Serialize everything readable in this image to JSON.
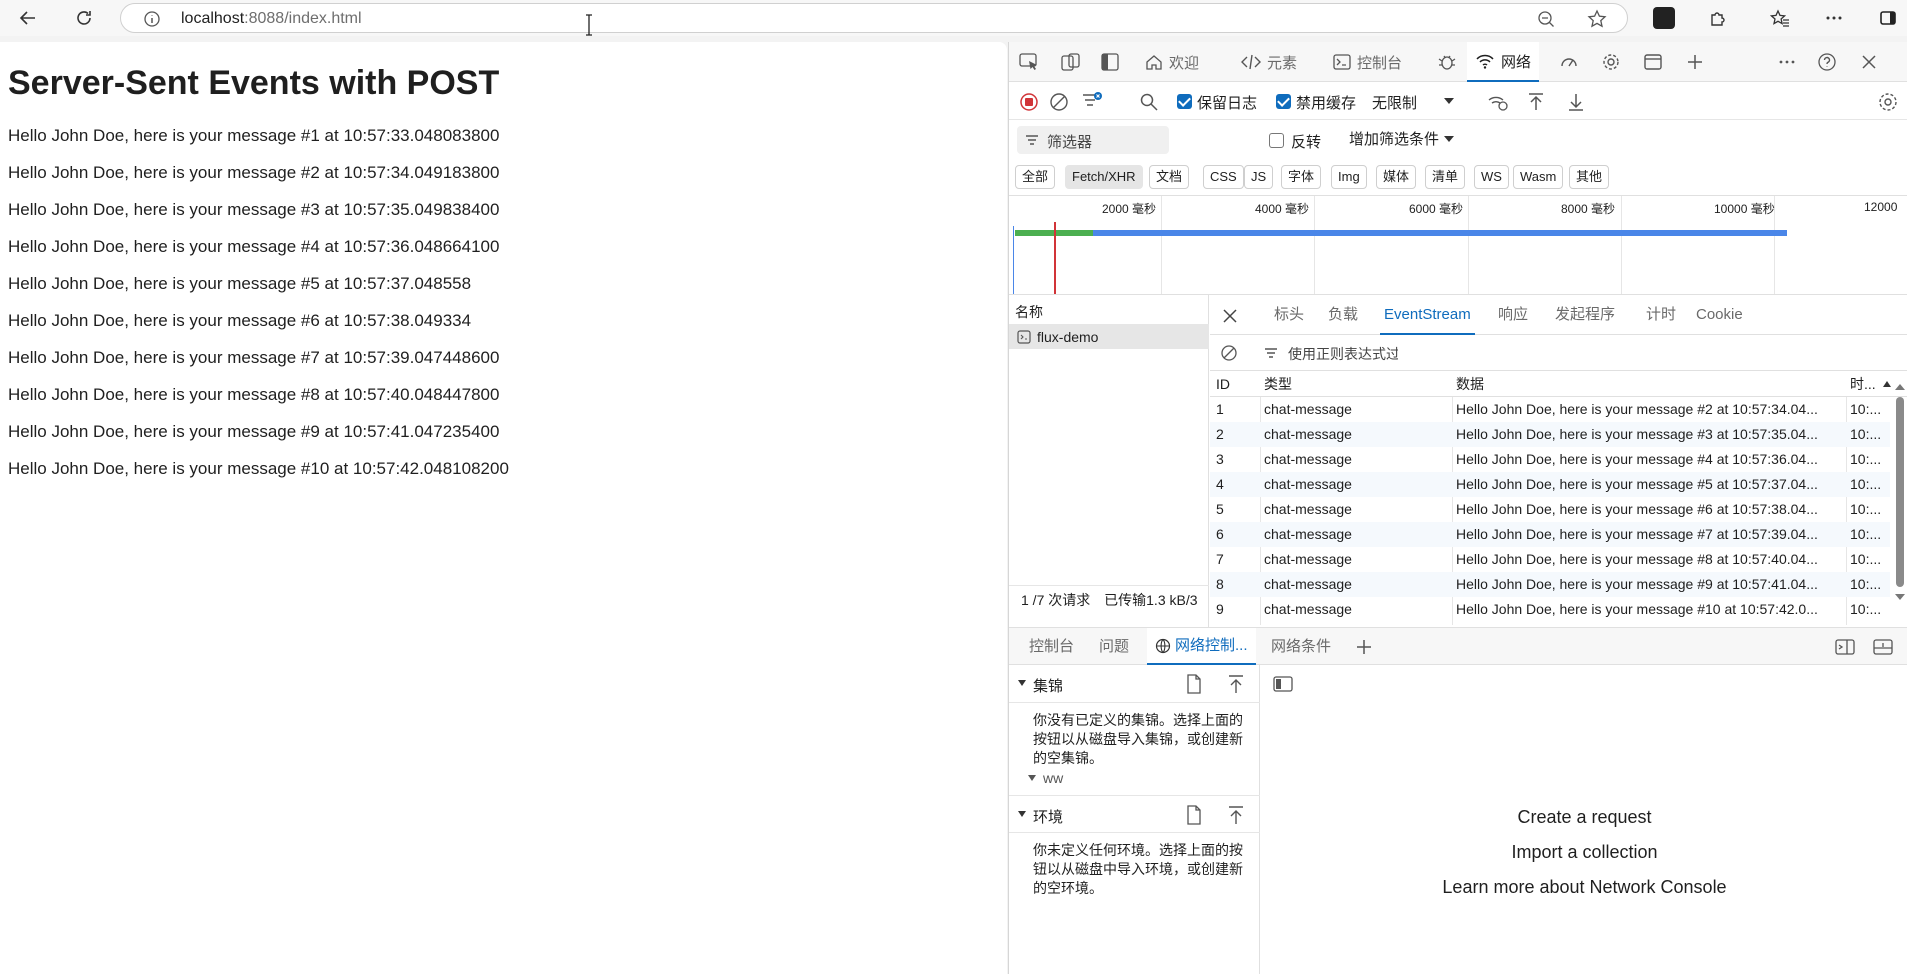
{
  "browser": {
    "url_host": "localhost",
    "url_path": ":8088/index.html"
  },
  "page": {
    "title": "Server-Sent Events with POST",
    "messages": [
      "Hello John Doe, here is your message #1 at 10:57:33.048083800",
      "Hello John Doe, here is your message #2 at 10:57:34.049183800",
      "Hello John Doe, here is your message #3 at 10:57:35.049838400",
      "Hello John Doe, here is your message #4 at 10:57:36.048664100",
      "Hello John Doe, here is your message #5 at 10:57:37.048558",
      "Hello John Doe, here is your message #6 at 10:57:38.049334",
      "Hello John Doe, here is your message #7 at 10:57:39.047448600",
      "Hello John Doe, here is your message #8 at 10:57:40.048447800",
      "Hello John Doe, here is your message #9 at 10:57:41.047235400",
      "Hello John Doe, here is your message #10 at 10:57:42.048108200"
    ]
  },
  "devtools": {
    "tabs": {
      "welcome": "欢迎",
      "elements": "元素",
      "console": "控制台",
      "network": "网络"
    },
    "toolbar": {
      "preserve_log": "保留日志",
      "disable_cache": "禁用缓存",
      "throttle": "无限制"
    },
    "filter": {
      "placeholder": "筛选器",
      "invert": "反转",
      "more_filters": "增加筛选条件"
    },
    "types": [
      "全部",
      "Fetch/XHR",
      "文档",
      "CSS",
      "JS",
      "字体",
      "Img",
      "媒体",
      "清单",
      "WS",
      "Wasm",
      "其他"
    ],
    "timeline_ticks": [
      "2000 毫秒",
      "4000 毫秒",
      "6000 毫秒",
      "8000 毫秒",
      "10000 毫秒",
      "12000"
    ],
    "requests": {
      "name_header": "名称",
      "rows": [
        "flux-demo"
      ],
      "status": "1 /7 次请求",
      "transferred": "已传输1.3 kB/3"
    },
    "detail_tabs": [
      "标头",
      "负载",
      "EventStream",
      "响应",
      "发起程序",
      "计时",
      "Cookie"
    ],
    "eventstream": {
      "filter_placeholder": "使用正则表达式过滤",
      "headers": [
        "ID",
        "类型",
        "数据",
        "时..."
      ],
      "rows": [
        [
          "1",
          "chat-message",
          "Hello John Doe, here is your message #2 at 10:57:34.04...",
          "10:..."
        ],
        [
          "2",
          "chat-message",
          "Hello John Doe, here is your message #3 at 10:57:35.04...",
          "10:..."
        ],
        [
          "3",
          "chat-message",
          "Hello John Doe, here is your message #4 at 10:57:36.04...",
          "10:..."
        ],
        [
          "4",
          "chat-message",
          "Hello John Doe, here is your message #5 at 10:57:37.04...",
          "10:..."
        ],
        [
          "5",
          "chat-message",
          "Hello John Doe, here is your message #6 at 10:57:38.04...",
          "10:..."
        ],
        [
          "6",
          "chat-message",
          "Hello John Doe, here is your message #7 at 10:57:39.04...",
          "10:..."
        ],
        [
          "7",
          "chat-message",
          "Hello John Doe, here is your message #8 at 10:57:40.04...",
          "10:..."
        ],
        [
          "8",
          "chat-message",
          "Hello John Doe, here is your message #9 at 10:57:41.04...",
          "10:..."
        ],
        [
          "9",
          "chat-message",
          "Hello John Doe, here is your message #10 at 10:57:42.0...",
          "10:..."
        ]
      ]
    },
    "drawer_tabs": [
      "控制台",
      "问题",
      "网络控制...",
      "网络条件"
    ],
    "network_console": {
      "collections_title": "集锦",
      "collections_body": "你没有已定义的集锦。选择上面的按钮以从磁盘导入集锦，或创建新的空集锦。",
      "collection_item": "ww",
      "environments_title": "环境",
      "environments_body": "你未定义任何环境。选择上面的按钮以从磁盘中导入环境，或创建新的空环境。",
      "create_request": "Create a request",
      "import_collection": "Import a collection",
      "learn_more": "Learn more about Network Console"
    }
  },
  "colors": {
    "accent": "#0f6cbd",
    "record_red": "#d13438",
    "timeline_green": "#4caf50",
    "timeline_blue": "#4a86e8"
  }
}
